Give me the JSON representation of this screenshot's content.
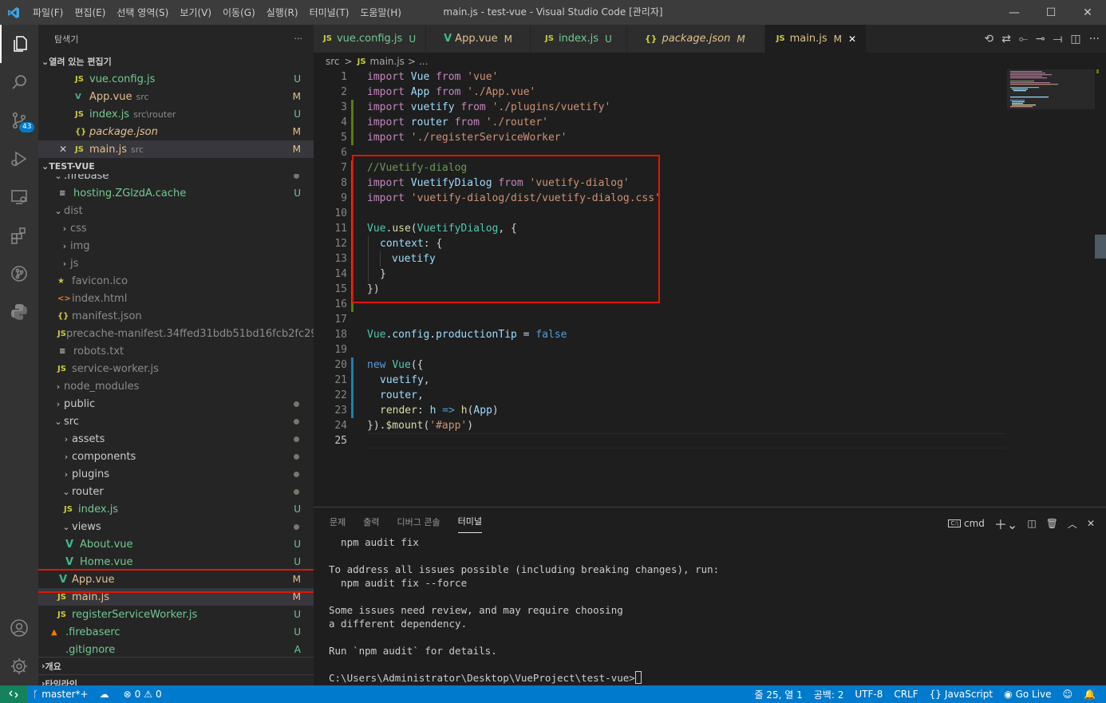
{
  "window": {
    "title": "main.js - test-vue - Visual Studio Code [관리자]",
    "menu": [
      "파일(F)",
      "편집(E)",
      "선택 영역(S)",
      "보기(V)",
      "이동(G)",
      "실행(R)",
      "터미널(T)",
      "도움말(H)"
    ]
  },
  "activity": {
    "scm_badge": "43",
    "icons": [
      "explorer-icon",
      "search-icon",
      "source-control-icon",
      "run-debug-icon",
      "remote-explorer-icon",
      "extensions-icon",
      "git-graph-icon",
      "python-icon",
      "account-icon",
      "settings-gear-icon"
    ]
  },
  "sidebar": {
    "title": "탐색기",
    "more": "···",
    "open_editors_label": "열려 있는 편집기",
    "open_editors": [
      {
        "icon": "JS",
        "name": "vue.config.js",
        "desc": "",
        "status": "U"
      },
      {
        "icon": "V",
        "name": "App.vue",
        "desc": "src",
        "status": "M"
      },
      {
        "icon": "JS",
        "name": "index.js",
        "desc": "src\\router",
        "status": "U"
      },
      {
        "icon": "{}",
        "name": "package.json",
        "desc": "",
        "status": "M"
      },
      {
        "icon": "JS",
        "name": "main.js",
        "desc": "src",
        "status": "M",
        "close": "✕"
      }
    ],
    "project_label": "TEST-VUE",
    "tree": [
      {
        "icon": "",
        "name": ".firebase",
        "status": "",
        "dot": true
      },
      {
        "icon": "≡",
        "name": "hosting.ZGlzdA.cache",
        "status": "U"
      },
      {
        "icon": "",
        "name": "dist",
        "status": ""
      },
      {
        "icon": "",
        "name": "css",
        "status": ""
      },
      {
        "icon": "",
        "name": "img",
        "status": ""
      },
      {
        "icon": "",
        "name": "js",
        "status": ""
      },
      {
        "icon": "★",
        "name": "favicon.ico",
        "status": ""
      },
      {
        "icon": "<>",
        "name": "index.html",
        "status": ""
      },
      {
        "icon": "{}",
        "name": "manifest.json",
        "status": ""
      },
      {
        "icon": "JS",
        "name": "precache-manifest.34ffed31bdb51bd16fcb2fc29d5...",
        "status": ""
      },
      {
        "icon": "≡",
        "name": "robots.txt",
        "status": ""
      },
      {
        "icon": "JS",
        "name": "service-worker.js",
        "status": ""
      },
      {
        "icon": "",
        "name": "node_modules",
        "status": ""
      },
      {
        "icon": "",
        "name": "public",
        "status": "",
        "dot": true
      },
      {
        "icon": "",
        "name": "src",
        "status": "",
        "dot": true
      },
      {
        "icon": "",
        "name": "assets",
        "status": "",
        "dot": true
      },
      {
        "icon": "",
        "name": "components",
        "status": "",
        "dot": true
      },
      {
        "icon": "",
        "name": "plugins",
        "status": "",
        "dot": true
      },
      {
        "icon": "",
        "name": "router",
        "status": "",
        "dot": true
      },
      {
        "icon": "JS",
        "name": "index.js",
        "status": "U"
      },
      {
        "icon": "",
        "name": "views",
        "status": "",
        "dot": true
      },
      {
        "icon": "V",
        "name": "About.vue",
        "status": "U"
      },
      {
        "icon": "V",
        "name": "Home.vue",
        "status": "U"
      },
      {
        "icon": "V",
        "name": "App.vue",
        "status": "M"
      },
      {
        "icon": "JS",
        "name": "main.js",
        "status": "M"
      },
      {
        "icon": "JS",
        "name": "registerServiceWorker.js",
        "status": "U"
      },
      {
        "icon": "",
        "name": ".firebaserc",
        "status": "U"
      },
      {
        "icon": "",
        "name": ".gitignore",
        "status": "A"
      }
    ],
    "outline_label": "개요",
    "timeline_label": "타임라인"
  },
  "tabs": [
    {
      "icon": "JS",
      "name": "vue.config.js",
      "status": "U"
    },
    {
      "icon": "V",
      "name": "App.vue",
      "status": "M"
    },
    {
      "icon": "JS",
      "name": "index.js",
      "status": "U"
    },
    {
      "icon": "{}",
      "name": "package.json",
      "status": "M"
    },
    {
      "icon": "JS",
      "name": "main.js",
      "status": "M",
      "close": "✕"
    }
  ],
  "breadcrumb": {
    "folder": "src",
    "sep": ">",
    "icon": "JS",
    "file": "main.js",
    "more": "..."
  },
  "code": {
    "line_numbers": [
      "1",
      "2",
      "3",
      "4",
      "5",
      "6",
      "7",
      "8",
      "9",
      "10",
      "11",
      "12",
      "13",
      "14",
      "15",
      "16",
      "17",
      "18",
      "19",
      "20",
      "21",
      "22",
      "23",
      "24",
      "25"
    ],
    "l1": [
      "import",
      "Vue",
      "from",
      "'vue'"
    ],
    "l2": [
      "import",
      "App",
      "from",
      "'./App.vue'"
    ],
    "l3": [
      "import",
      "vuetify",
      "from",
      "'./plugins/vuetify'"
    ],
    "l4": [
      "import",
      "router",
      "from",
      "'./router'"
    ],
    "l5": [
      "import",
      "'./registerServiceWorker'"
    ],
    "l7": "//Vuetify-dialog",
    "l8": [
      "import",
      "VuetifyDialog",
      "from",
      "'vuetify-dialog'"
    ],
    "l9": [
      "import",
      "'vuetify-dialog/dist/vuetify-dialog.css'"
    ],
    "l11": [
      "Vue",
      ".",
      "use",
      "(",
      "VuetifyDialog",
      ", {"
    ],
    "l12": [
      "context",
      ": {"
    ],
    "l13": "vuetify",
    "l14": "}",
    "l15": "})",
    "l18": [
      "Vue",
      ".",
      "config",
      ".",
      "productionTip",
      " = ",
      "false"
    ],
    "l20": [
      "new",
      "Vue",
      "({"
    ],
    "l21": [
      "vuetify",
      ","
    ],
    "l22": [
      "router",
      ","
    ],
    "l23": [
      "render",
      ": ",
      "h",
      " => ",
      "h",
      "(",
      "App",
      ")"
    ],
    "l24": [
      "}).",
      "$mount",
      "(",
      "'#app'",
      ")"
    ]
  },
  "panel": {
    "tabs": [
      "문제",
      "출력",
      "디버그 콘솔",
      "터미널"
    ],
    "shell": "cmd",
    "terminal_lines": [
      "  npm audit fix",
      "",
      "To address all issues possible (including breaking changes), run:",
      "  npm audit fix --force",
      "",
      "Some issues need review, and may require choosing",
      "a different dependency.",
      "",
      "Run `npm audit` for details.",
      "",
      "C:\\Users\\Administrator\\Desktop\\VueProject\\test-vue>"
    ]
  },
  "statusbar": {
    "branch": "master*+",
    "sync": "",
    "errors": "0",
    "warnings": "0",
    "position": "줄 25, 열 1",
    "spaces": "공백: 2",
    "encoding": "UTF-8",
    "eol": "CRLF",
    "language": "JavaScript",
    "golive": "Go Live"
  },
  "colors": {
    "accent": "#007acc",
    "highlight_box": "#e51400",
    "untracked": "#73c991",
    "modified": "#e2c08d"
  }
}
